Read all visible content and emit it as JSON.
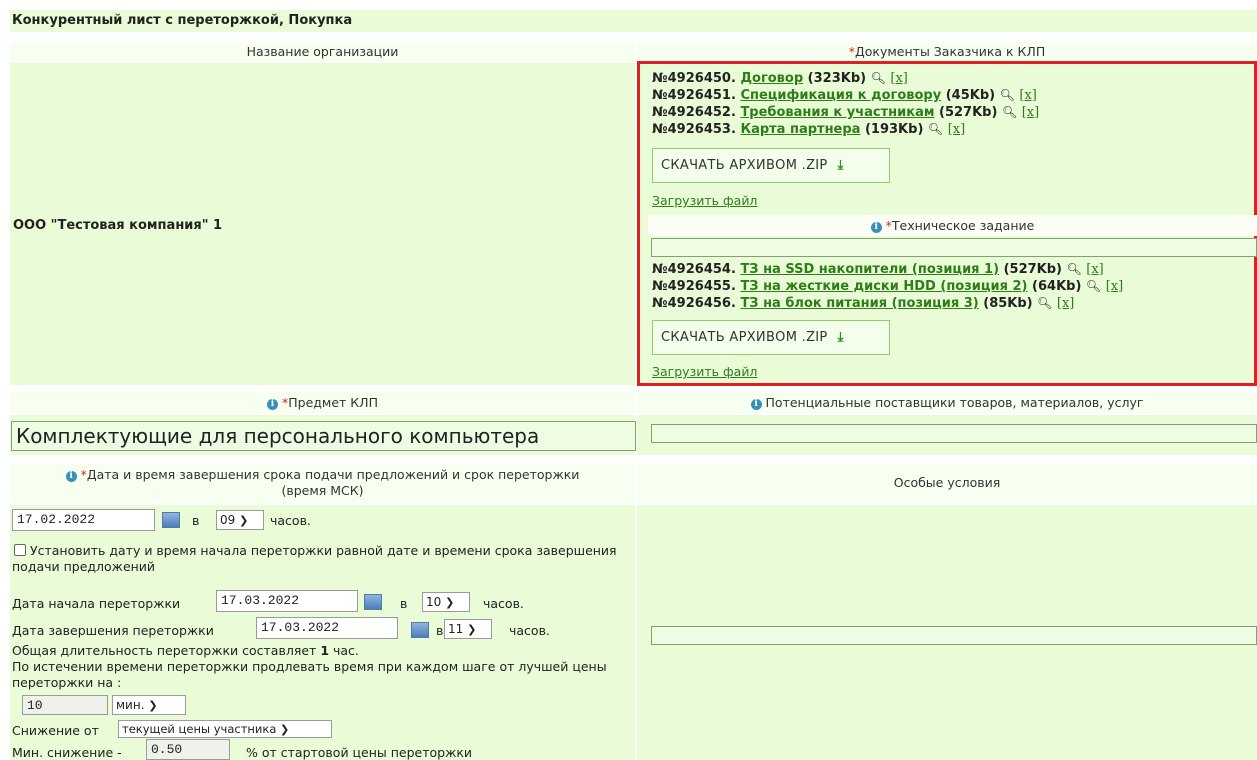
{
  "page_title": "Конкурентный лист с переторжкой, Покупка",
  "headers": {
    "org": "Название организации",
    "docs_required": "*",
    "docs": "Документы Заказчика к КЛП"
  },
  "org_name": "ООО \"Тестовая компания\" 1",
  "customer_docs": [
    {
      "num": "№4926450.",
      "name": "Договор",
      "size": "(323Kb)",
      "remove": "[x]"
    },
    {
      "num": "№4926451.",
      "name": "Спецификация к договору",
      "size": "(45Kb)",
      "remove": "[x]"
    },
    {
      "num": "№4926452.",
      "name": "Требования к участникам",
      "size": "(527Kb)",
      "remove": "[x]"
    },
    {
      "num": "№4926453.",
      "name": "Карта партнера",
      "size": "(193Kb)",
      "remove": "[x]"
    }
  ],
  "zip_label": "СКАЧАТЬ АРХИВОМ .ZIP",
  "upload_label": "Загрузить файл",
  "tech_task": {
    "required": "*",
    "label": "Техническое задание"
  },
  "tech_docs": [
    {
      "num": "№4926454.",
      "name": "ТЗ на SSD накопители (позиция 1)",
      "size": "(527Kb)",
      "remove": "[x]"
    },
    {
      "num": "№4926455.",
      "name": "ТЗ на жесткие диски HDD (позиция 2)",
      "size": "(64Kb)",
      "remove": "[x]"
    },
    {
      "num": "№4926456.",
      "name": "ТЗ на блок питания (позиция 3)",
      "size": "(85Kb)",
      "remove": "[x]"
    }
  ],
  "subject": {
    "required": "*",
    "label": "Предмет КЛП",
    "value": "Комплектующие для персонального компьютера"
  },
  "suppliers": {
    "label": "Потенциальные поставщики товаров, материалов, услуг"
  },
  "deadline": {
    "required": "*",
    "label": "Дата и время завершения срока подачи предложений и срок переторжки (время МСК)",
    "date": "17.02.2022",
    "at": "в",
    "hour": "09",
    "hours_word": "часов."
  },
  "special_conditions": "Особые условия",
  "same_date_checkbox": "Установить дату и время начала переторжки равной дате и времени срока завершения подачи предложений",
  "rebid_start": {
    "label": "Дата начала переторжки",
    "date": "17.03.2022",
    "at": "в",
    "hour": "10",
    "hours_word": "часов."
  },
  "rebid_end": {
    "label": "Дата завершения переторжки",
    "date": "17.03.2022",
    "at": "в",
    "hour": "11",
    "hours_word": "часов."
  },
  "duration": {
    "text": "Общая длительность переторжки составляет",
    "value": "1",
    "unit": "час."
  },
  "extend_text": "По истечении времени переторжки продлевать время при каждом шаге от лучшей цены переторжки на :",
  "extend": {
    "value": "10",
    "unit": "мин."
  },
  "decrease_from": {
    "label": "Снижение от",
    "option": "текущей цены участника"
  },
  "min_decrease": {
    "label": "Мин. снижение -",
    "value": "0.50",
    "suffix": "% от стартовой цены переторжки"
  },
  "colors": {
    "accent_green": "#2e7d18",
    "highlight_red": "#e02020",
    "panel_green": "#e9fbd7"
  }
}
